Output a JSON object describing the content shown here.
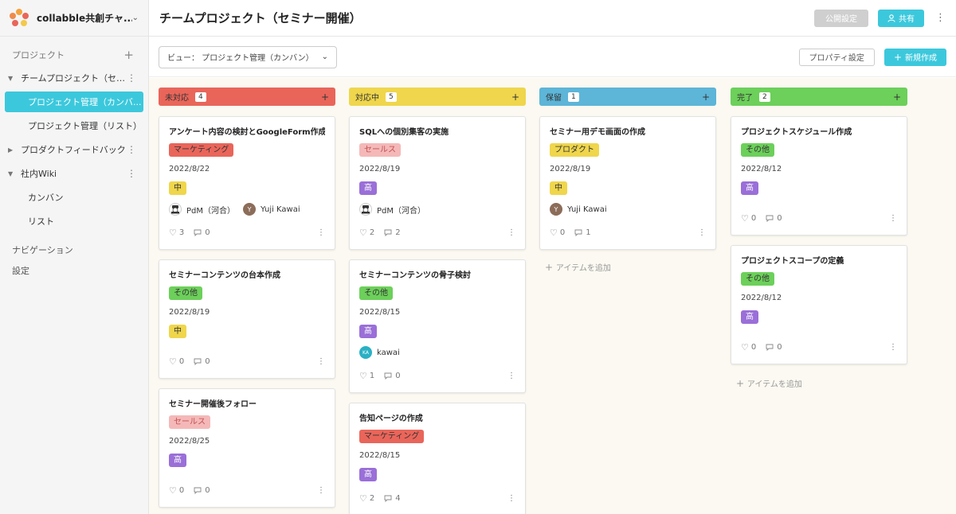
{
  "workspace": {
    "name": "collabble共創チャ..."
  },
  "sidebar": {
    "projects_label": "プロジェクト",
    "projects": [
      {
        "label": "チームプロジェクト（セミ...",
        "expanded": true,
        "children": [
          {
            "label": "プロジェクト管理（カンバ...",
            "active": true
          },
          {
            "label": "プロジェクト管理（リスト）",
            "active": false
          }
        ]
      },
      {
        "label": "プロダクトフィードバック",
        "expanded": false,
        "children": []
      },
      {
        "label": "社内Wiki",
        "expanded": true,
        "children": [
          {
            "label": "カンバン",
            "active": false
          },
          {
            "label": "リスト",
            "active": false
          }
        ]
      }
    ],
    "navigation_label": "ナビゲーション",
    "settings_label": "設定"
  },
  "header": {
    "title": "チームプロジェクト（セミナー開催）",
    "public_settings": "公開設定",
    "share": "共有"
  },
  "toolbar": {
    "view_label": "ビュー：  プロジェクト管理（カンバン）",
    "property_settings": "プロパティ設定",
    "new_create": "新規作成"
  },
  "add_item_label": "アイテムを追加",
  "columns": [
    {
      "name": "未対応",
      "count": "4",
      "color": "#e9655a",
      "cards": [
        {
          "title": "アンケート内容の検討とGoogleForm作成",
          "tag": "マーケティング",
          "tag_color": "#e9655a",
          "tag_text": "#333",
          "date": "2022/8/22",
          "priority": "中",
          "assignees": [
            {
              "name": "PdM（河合）",
              "type": "pdm"
            },
            {
              "name": "Yuji Kawai",
              "type": "Y"
            }
          ],
          "likes": "3",
          "comments": "0"
        },
        {
          "title": "セミナーコンテンツの台本作成",
          "tag": "その他",
          "tag_color": "#6cd05a",
          "tag_text": "#333",
          "date": "2022/8/19",
          "priority": "中",
          "assignees": [],
          "likes": "0",
          "comments": "0"
        },
        {
          "title": "セミナー開催後フォロー",
          "tag": "セールス",
          "tag_color": "#f5b8b8",
          "tag_text": "#c05050",
          "date": "2022/8/25",
          "priority": "高",
          "assignees": [],
          "likes": "0",
          "comments": "0"
        }
      ]
    },
    {
      "name": "対応中",
      "count": "5",
      "color": "#efd64c",
      "cards": [
        {
          "title": "SQLへの個別集客の実施",
          "tag": "セールス",
          "tag_color": "#f5b8b8",
          "tag_text": "#c05050",
          "date": "2022/8/19",
          "priority": "高",
          "assignees": [
            {
              "name": "PdM（河合）",
              "type": "pdm"
            }
          ],
          "likes": "2",
          "comments": "2"
        },
        {
          "title": "セミナーコンテンツの骨子検討",
          "tag": "その他",
          "tag_color": "#6cd05a",
          "tag_text": "#333",
          "date": "2022/8/15",
          "priority": "高",
          "assignees": [
            {
              "name": "kawai",
              "type": "ka"
            }
          ],
          "likes": "1",
          "comments": "0"
        },
        {
          "title": "告知ページの作成",
          "tag": "マーケティング",
          "tag_color": "#e9655a",
          "tag_text": "#333",
          "date": "2022/8/15",
          "priority": "高",
          "assignees": [],
          "likes": "2",
          "comments": "4"
        }
      ]
    },
    {
      "name": "保留",
      "count": "1",
      "color": "#5db5d8",
      "cards": [
        {
          "title": "セミナー用デモ画面の作成",
          "tag": "プロダクト",
          "tag_color": "#efd64c",
          "tag_text": "#333",
          "date": "2022/8/19",
          "priority": "中",
          "assignees": [
            {
              "name": "Yuji Kawai",
              "type": "Y"
            }
          ],
          "likes": "0",
          "comments": "1"
        }
      ]
    },
    {
      "name": "完了",
      "count": "2",
      "color": "#6cd05a",
      "cards": [
        {
          "title": "プロジェクトスケジュール作成",
          "tag": "その他",
          "tag_color": "#6cd05a",
          "tag_text": "#333",
          "date": "2022/8/12",
          "priority": "高",
          "assignees": [],
          "likes": "0",
          "comments": "0"
        },
        {
          "title": "プロジェクトスコープの定義",
          "tag": "その他",
          "tag_color": "#6cd05a",
          "tag_text": "#333",
          "date": "2022/8/12",
          "priority": "高",
          "assignees": [],
          "likes": "0",
          "comments": "0"
        }
      ]
    }
  ],
  "colors": {
    "accent": "#3cc8dc",
    "priority_mid": "#efd64c",
    "priority_high": "#9a6fd8"
  }
}
